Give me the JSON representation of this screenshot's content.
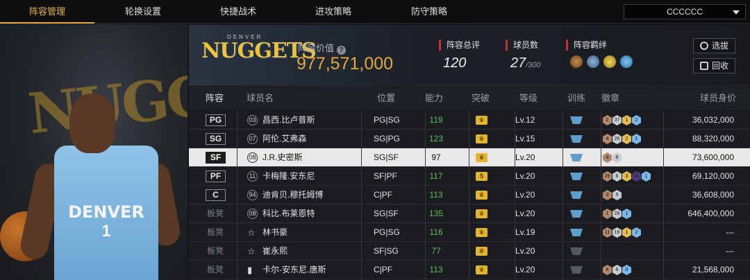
{
  "nav": {
    "tabs": [
      "阵容管理",
      "轮换设置",
      "快捷战术",
      "进攻策略",
      "防守策略"
    ],
    "dropdown": "CCCCCC"
  },
  "art": {
    "jersey_text": "DENVER",
    "jersey_number": "1",
    "logo_text": "NUGGETS"
  },
  "header": {
    "logo": "NUGGETS",
    "logo_small": "DENVER",
    "value_label": "阵容价值",
    "value": "977,571,000",
    "stats": {
      "rating_label": "阵容总评",
      "rating": "120",
      "players_label": "球员数",
      "players": "27",
      "players_total": "/300",
      "bonds_label": "阵容羁绊"
    },
    "buttons": {
      "select": "选拔",
      "recycle": "回收"
    }
  },
  "table": {
    "columns": [
      "阵容",
      "球员名",
      "位置",
      "能力",
      "突破",
      "等级",
      "训练",
      "徽章",
      "球员身价"
    ],
    "rows": [
      {
        "slot": "PG",
        "bench": false,
        "num": "03",
        "name": "昌西.比卢普斯",
        "pos": "PG|SG",
        "ability": "119",
        "breakthrough": "crown",
        "level": "Lv.12",
        "train": "blue",
        "badges": [
          [
            "h-bronze",
            "2"
          ],
          [
            "h-silver",
            "37"
          ],
          [
            "h-gold",
            "1"
          ],
          [
            "h-blue",
            "2"
          ]
        ],
        "salary": "36,032,000",
        "selected": false
      },
      {
        "slot": "SG",
        "bench": false,
        "num": "07",
        "name": "阿伦.艾弗森",
        "pos": "SG|PG",
        "ability": "123",
        "breakthrough": "crown",
        "level": "Lv.15",
        "train": "blue",
        "badges": [
          [
            "h-bronze",
            "4"
          ],
          [
            "h-silver",
            "26"
          ],
          [
            "h-gold",
            "2"
          ],
          [
            "h-blue",
            "1"
          ]
        ],
        "salary": "88,320,000",
        "selected": false
      },
      {
        "slot": "SF",
        "bench": false,
        "num": "08",
        "name": "J.R.史密斯",
        "pos": "SG|SF",
        "ability": "97",
        "breakthrough": "crown",
        "level": "Lv.20",
        "train": "blue",
        "badges": [
          [
            "h-bronze",
            "4"
          ],
          [
            "h-silver",
            "8"
          ]
        ],
        "salary": "73,600,000",
        "selected": true
      },
      {
        "slot": "PF",
        "bench": false,
        "num": "11",
        "name": "卡梅隆.安东尼",
        "pos": "SF|PF",
        "ability": "117",
        "breakthrough": "5",
        "level": "Lv.20",
        "train": "blue",
        "badges": [
          [
            "h-bronze",
            "26"
          ],
          [
            "h-silver",
            "6"
          ],
          [
            "h-gold",
            "3"
          ],
          [
            "h-purple",
            "0"
          ],
          [
            "h-blue",
            "1"
          ]
        ],
        "salary": "69,120,000",
        "selected": false
      },
      {
        "slot": "C",
        "bench": false,
        "num": "94",
        "name": "迪肯贝.穆托姆博",
        "pos": "C|PF",
        "ability": "113",
        "breakthrough": "crown",
        "level": "Lv.20",
        "train": "blue",
        "badges": [
          [
            "h-bronze",
            "3"
          ],
          [
            "h-silver",
            "5"
          ]
        ],
        "salary": "36,608,000",
        "selected": false
      },
      {
        "slot": "板凳",
        "bench": true,
        "num": "08",
        "name": "科比.布莱恩特",
        "pos": "SG|SF",
        "ability": "135",
        "breakthrough": "crown",
        "level": "Lv.20",
        "train": "blue",
        "badges": [
          [
            "h-bronze",
            "1"
          ],
          [
            "h-silver",
            "29"
          ],
          [
            "h-blue",
            "1"
          ]
        ],
        "salary": "646,400,000",
        "selected": false
      },
      {
        "slot": "板凳",
        "bench": true,
        "num": "star",
        "name": "林书豪",
        "pos": "PG|SG",
        "ability": "116",
        "breakthrough": "crown",
        "level": "Lv.19",
        "train": "blue",
        "badges": [
          [
            "h-bronze",
            "11"
          ],
          [
            "h-silver",
            "19"
          ],
          [
            "h-gold",
            "1"
          ],
          [
            "h-blue",
            "2"
          ]
        ],
        "salary": "---",
        "selected": false
      },
      {
        "slot": "板凳",
        "bench": true,
        "num": "star",
        "name": "崔永熙",
        "pos": "SF|SG",
        "ability": "77",
        "breakthrough": "crown",
        "level": "Lv.20",
        "train": "gray",
        "badges": [],
        "salary": "---",
        "selected": false
      },
      {
        "slot": "板凳",
        "bench": true,
        "num": "bars",
        "name": "卡尔-安东尼.唐斯",
        "pos": "C|PF",
        "ability": "113",
        "breakthrough": "crown",
        "level": "Lv.20",
        "train": "gray",
        "badges": [
          [
            "h-bronze",
            "6"
          ],
          [
            "h-silver",
            "6"
          ],
          [
            "h-blue",
            "0"
          ]
        ],
        "salary": "21,568,000",
        "selected": false
      }
    ]
  },
  "colors": {
    "accent": "#e9b23c",
    "value": "#e4a93a",
    "ability": "#5fc15f",
    "selected_row": "#e9e9e9"
  }
}
